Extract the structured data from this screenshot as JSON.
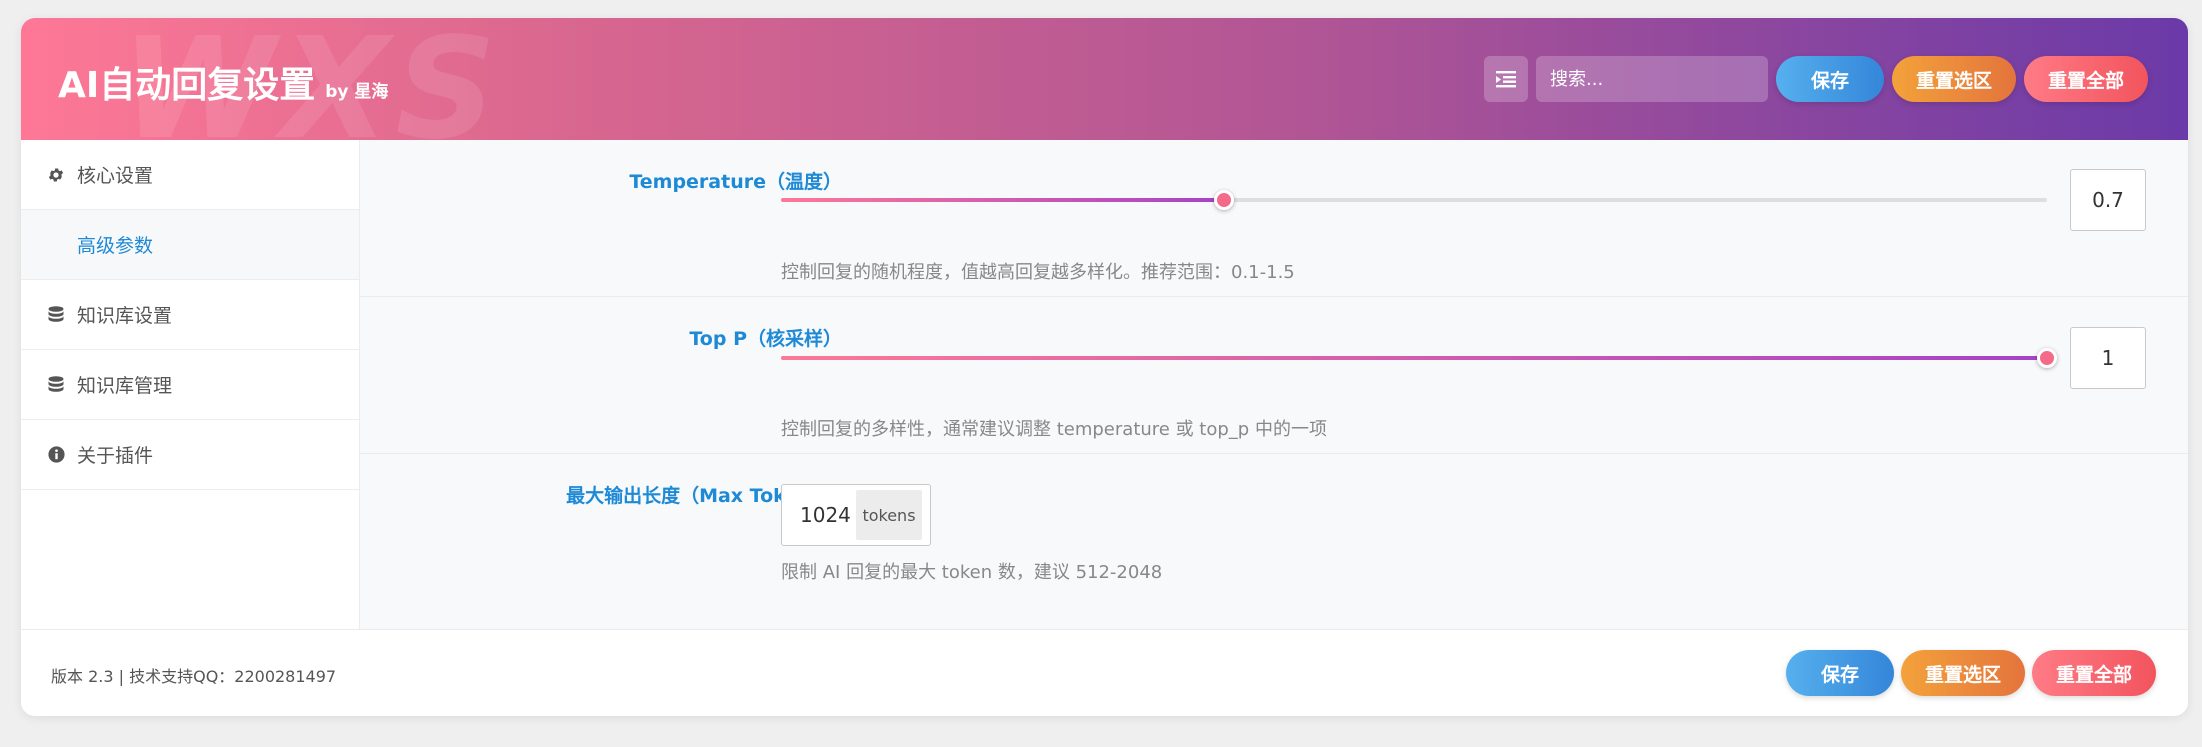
{
  "header": {
    "title": "AI自动回复设置",
    "by": "by 星海",
    "watermark": "WXS",
    "search_placeholder": "搜索...",
    "save_label": "保存",
    "reset_selected_label": "重置选区",
    "reset_all_label": "重置全部",
    "gradient_start": "#fe7896",
    "gradient_end": "#6b3aa8"
  },
  "sidebar": {
    "items": [
      {
        "label": "核心设置",
        "icon": "gear-icon"
      },
      {
        "label": "高级参数",
        "icon": "",
        "active": true
      },
      {
        "label": "知识库设置",
        "icon": "database-icon"
      },
      {
        "label": "知识库管理",
        "icon": "database-icon"
      },
      {
        "label": "关于插件",
        "icon": "info-icon"
      }
    ]
  },
  "settings": {
    "temperature": {
      "label": "Temperature（温度）",
      "value": "0.7",
      "fraction": 0.35,
      "desc": "控制回复的随机程度，值越高回复越多样化。推荐范围：0.1-1.5"
    },
    "top_p": {
      "label": "Top P（核采样）",
      "value": "1",
      "fraction": 1.0,
      "desc": "控制回复的多样性，通常建议调整 temperature 或 top_p 中的一项"
    },
    "max_tokens": {
      "label": "最大输出长度（Max Tokens）",
      "value": "1024",
      "unit": "tokens",
      "desc": "限制 AI 回复的最大 token 数，建议 512-2048"
    }
  },
  "footer": {
    "info": "版本 2.3 | 技术支持QQ：2200281497",
    "save_label": "保存",
    "reset_selected_label": "重置选区",
    "reset_all_label": "重置全部"
  },
  "colors": {
    "accent_blue": "#1e8ad6",
    "slider_start": "#fe7896",
    "slider_end": "#a642c7"
  }
}
